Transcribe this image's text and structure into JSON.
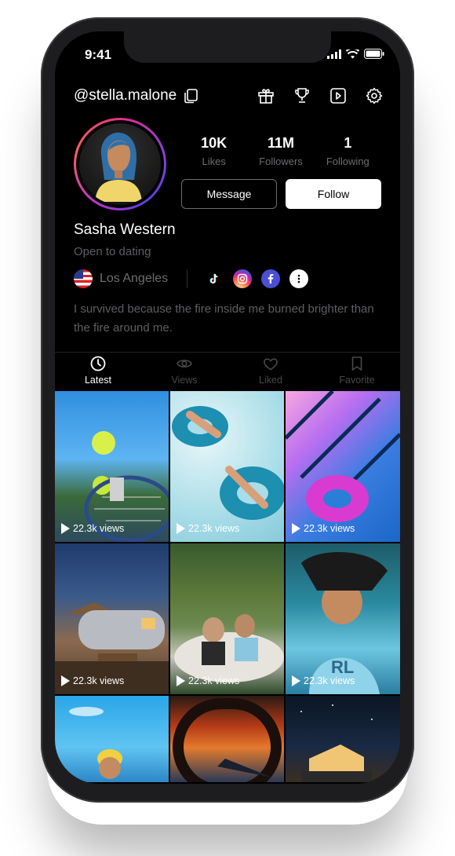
{
  "status_bar": {
    "time": "9:41"
  },
  "profile": {
    "handle": "@stella.malone",
    "name": "Sasha Western",
    "status": "Open to dating",
    "location": "Los Angeles",
    "bio": "I survived because the fire inside me burned brighter than the fire around me."
  },
  "stats": [
    {
      "value": "10K",
      "label": "Likes"
    },
    {
      "value": "11M",
      "label": "Followers"
    },
    {
      "value": "1",
      "label": "Following"
    }
  ],
  "buttons": {
    "message": "Message",
    "follow": "Follow"
  },
  "header_icons": [
    "gift-icon",
    "trophy-icon",
    "play-square-icon",
    "gear-icon"
  ],
  "socials": [
    "tiktok-icon",
    "instagram-icon",
    "facebook-icon",
    "more-icon"
  ],
  "tabs": [
    {
      "label": "Latest",
      "icon": "clock-icon",
      "active": true
    },
    {
      "label": "Views",
      "icon": "eye-icon",
      "active": false
    },
    {
      "label": "Liked",
      "icon": "heart-icon",
      "active": false
    },
    {
      "label": "Favorite",
      "icon": "bookmark-icon",
      "active": false
    }
  ],
  "posts": [
    {
      "views": "22.3k views"
    },
    {
      "views": "22.3k views"
    },
    {
      "views": "22.3k views"
    },
    {
      "views": "22.3k views"
    },
    {
      "views": "22.3k views"
    },
    {
      "views": "22.3k views"
    }
  ],
  "colors": {
    "background": "#000000",
    "accent_ring_start": "#e2308b",
    "accent_ring_end": "#5b3ee0",
    "muted_text": "#6c6c70"
  }
}
